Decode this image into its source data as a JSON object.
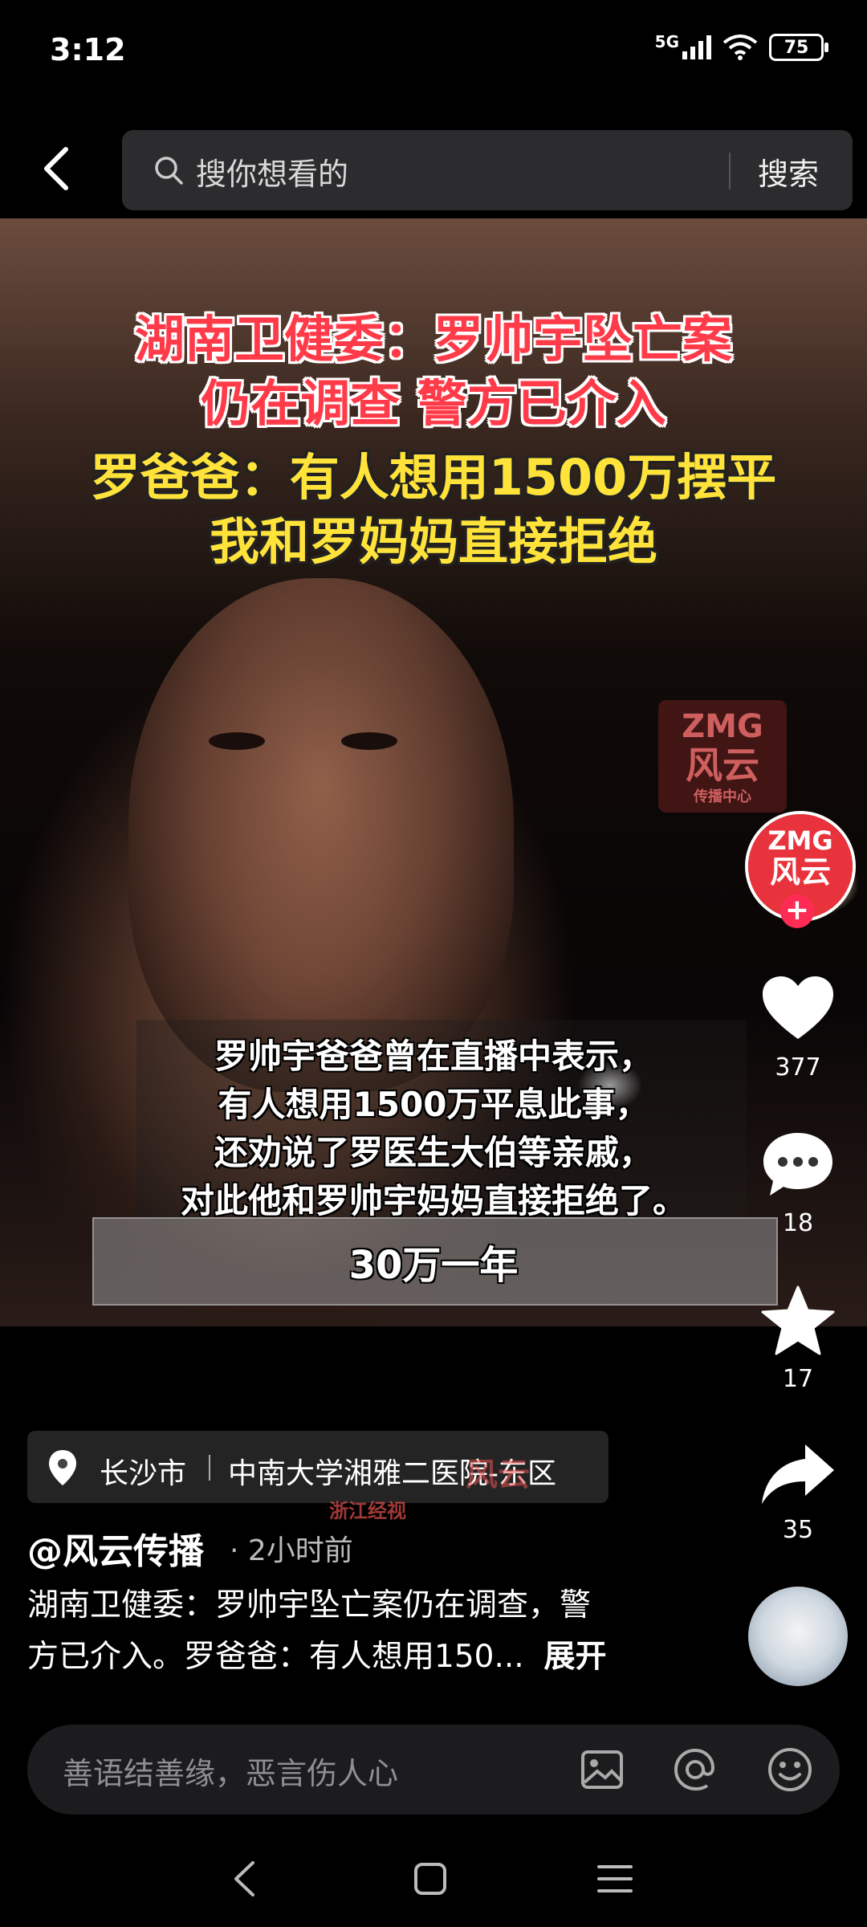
{
  "status_bar": {
    "time": "3:12",
    "network": "5G",
    "battery": "75"
  },
  "search": {
    "placeholder": "搜你想看的",
    "button_label": "搜索"
  },
  "video": {
    "headline_red_line1": "湖南卫健委：罗帅宇坠亡案",
    "headline_red_line2": "仍在调查 警方已介入",
    "headline_yellow_line1": "罗爸爸：有人想用1500万摆平",
    "headline_yellow_line2": "我和罗妈妈直接拒绝",
    "watermark_line1": "ZMG",
    "watermark_line2": "风云",
    "watermark_line3": "传播中心",
    "subtitles": [
      "罗帅宇爸爸曾在直播中表示，",
      "有人想用1500万平息此事，",
      "还劝说了罗医生大伯等亲戚，",
      "对此他和罗帅宇妈妈直接拒绝了。"
    ],
    "price_caption": "30万一年",
    "bottom_watermark_1": "浙江经视",
    "bottom_watermark_2": "风云"
  },
  "actions": {
    "likes": "377",
    "comments": "18",
    "favorites": "17",
    "shares": "35",
    "follow_symbol": "+"
  },
  "location": {
    "city": "长沙市",
    "place": "中南大学湘雅二医院-东区"
  },
  "post": {
    "author": "@风云传播",
    "time_ago": "· 2小时前",
    "description_line1": "湖南卫健委：罗帅宇坠亡案仍在调查，警",
    "description_line2": "方已介入。罗爸爸：有人想用150...",
    "expand_label": "展开"
  },
  "comment_bar": {
    "placeholder": "善语结善缘，恶言伤人心"
  },
  "colors": {
    "accent": "#fe2c55",
    "headline_red": "#ff3b4a",
    "headline_yellow": "#ffe23a"
  },
  "icons": [
    "back-arrow-icon",
    "search-icon",
    "heart-icon",
    "comment-icon",
    "star-icon",
    "share-icon",
    "location-pin-icon",
    "image-icon",
    "at-icon",
    "emoji-icon",
    "nav-back-icon",
    "nav-home-icon",
    "nav-menu-icon"
  ]
}
